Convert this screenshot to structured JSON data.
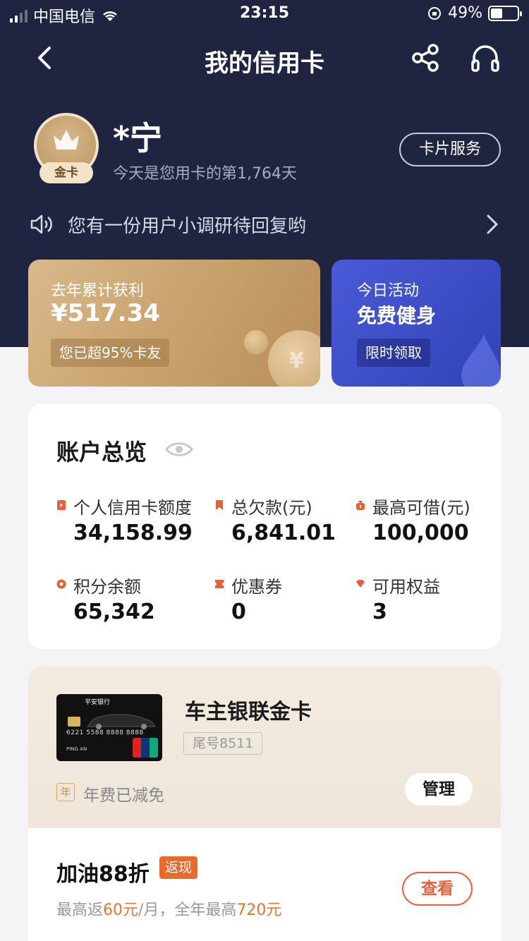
{
  "status_bar": {
    "carrier": "中国电信",
    "time": "23:15",
    "battery": "49%"
  },
  "nav": {
    "title": "我的信用卡"
  },
  "user": {
    "badge": "金卡",
    "name": "*宁",
    "days_text": "今天是您用卡的第1,764天",
    "card_service_label": "卡片服务"
  },
  "notice": {
    "text": "您有一份用户小调研待回复哟"
  },
  "promo_gold": {
    "label": "去年累计获利",
    "amount": "¥517.34",
    "tag": "您已超95%卡友",
    "coin_symbol": "¥"
  },
  "promo_blue": {
    "label": "今日活动",
    "headline": "免费健身",
    "tag": "限时领取"
  },
  "overview": {
    "title": "账户总览",
    "stats": [
      {
        "label": "个人信用卡额度",
        "value": "34,158.99",
        "icon": "credit-limit-icon",
        "color": "#e8603a"
      },
      {
        "label": "总欠款(元)",
        "value": "6,841.01",
        "icon": "bookmark-icon",
        "color": "#e8603a"
      },
      {
        "label": "最高可借(元)",
        "value": "100,000",
        "icon": "money-bag-icon",
        "color": "#e8603a"
      },
      {
        "label": "积分余额",
        "value": "65,342",
        "icon": "points-icon",
        "color": "#e8603a"
      },
      {
        "label": "优惠券",
        "value": "0",
        "icon": "coupon-icon",
        "color": "#e8603a"
      },
      {
        "label": "可用权益",
        "value": "3",
        "icon": "diamond-icon",
        "color": "#e8603a"
      }
    ]
  },
  "card": {
    "image_text": {
      "bank": "平安银行",
      "number": "6221 5588 8888 8888",
      "holder": "PING AN"
    },
    "name": "车主银联金卡",
    "tail_number": "尾号8511",
    "fee_icon_text": "年",
    "fee_text": "年费已减免",
    "manage_label": "管理"
  },
  "offer": {
    "title": "加油88折",
    "tag": "返现",
    "desc_part1": "最高返",
    "desc_highlight1": "60元",
    "desc_part2": "/月，全年最高",
    "desc_highlight2": "720元",
    "view_label": "查看"
  },
  "colors": {
    "header_bg": "#1f2440",
    "accent_orange": "#e8603a",
    "gold": "#c7a06a",
    "blue": "#3a4bc8"
  }
}
